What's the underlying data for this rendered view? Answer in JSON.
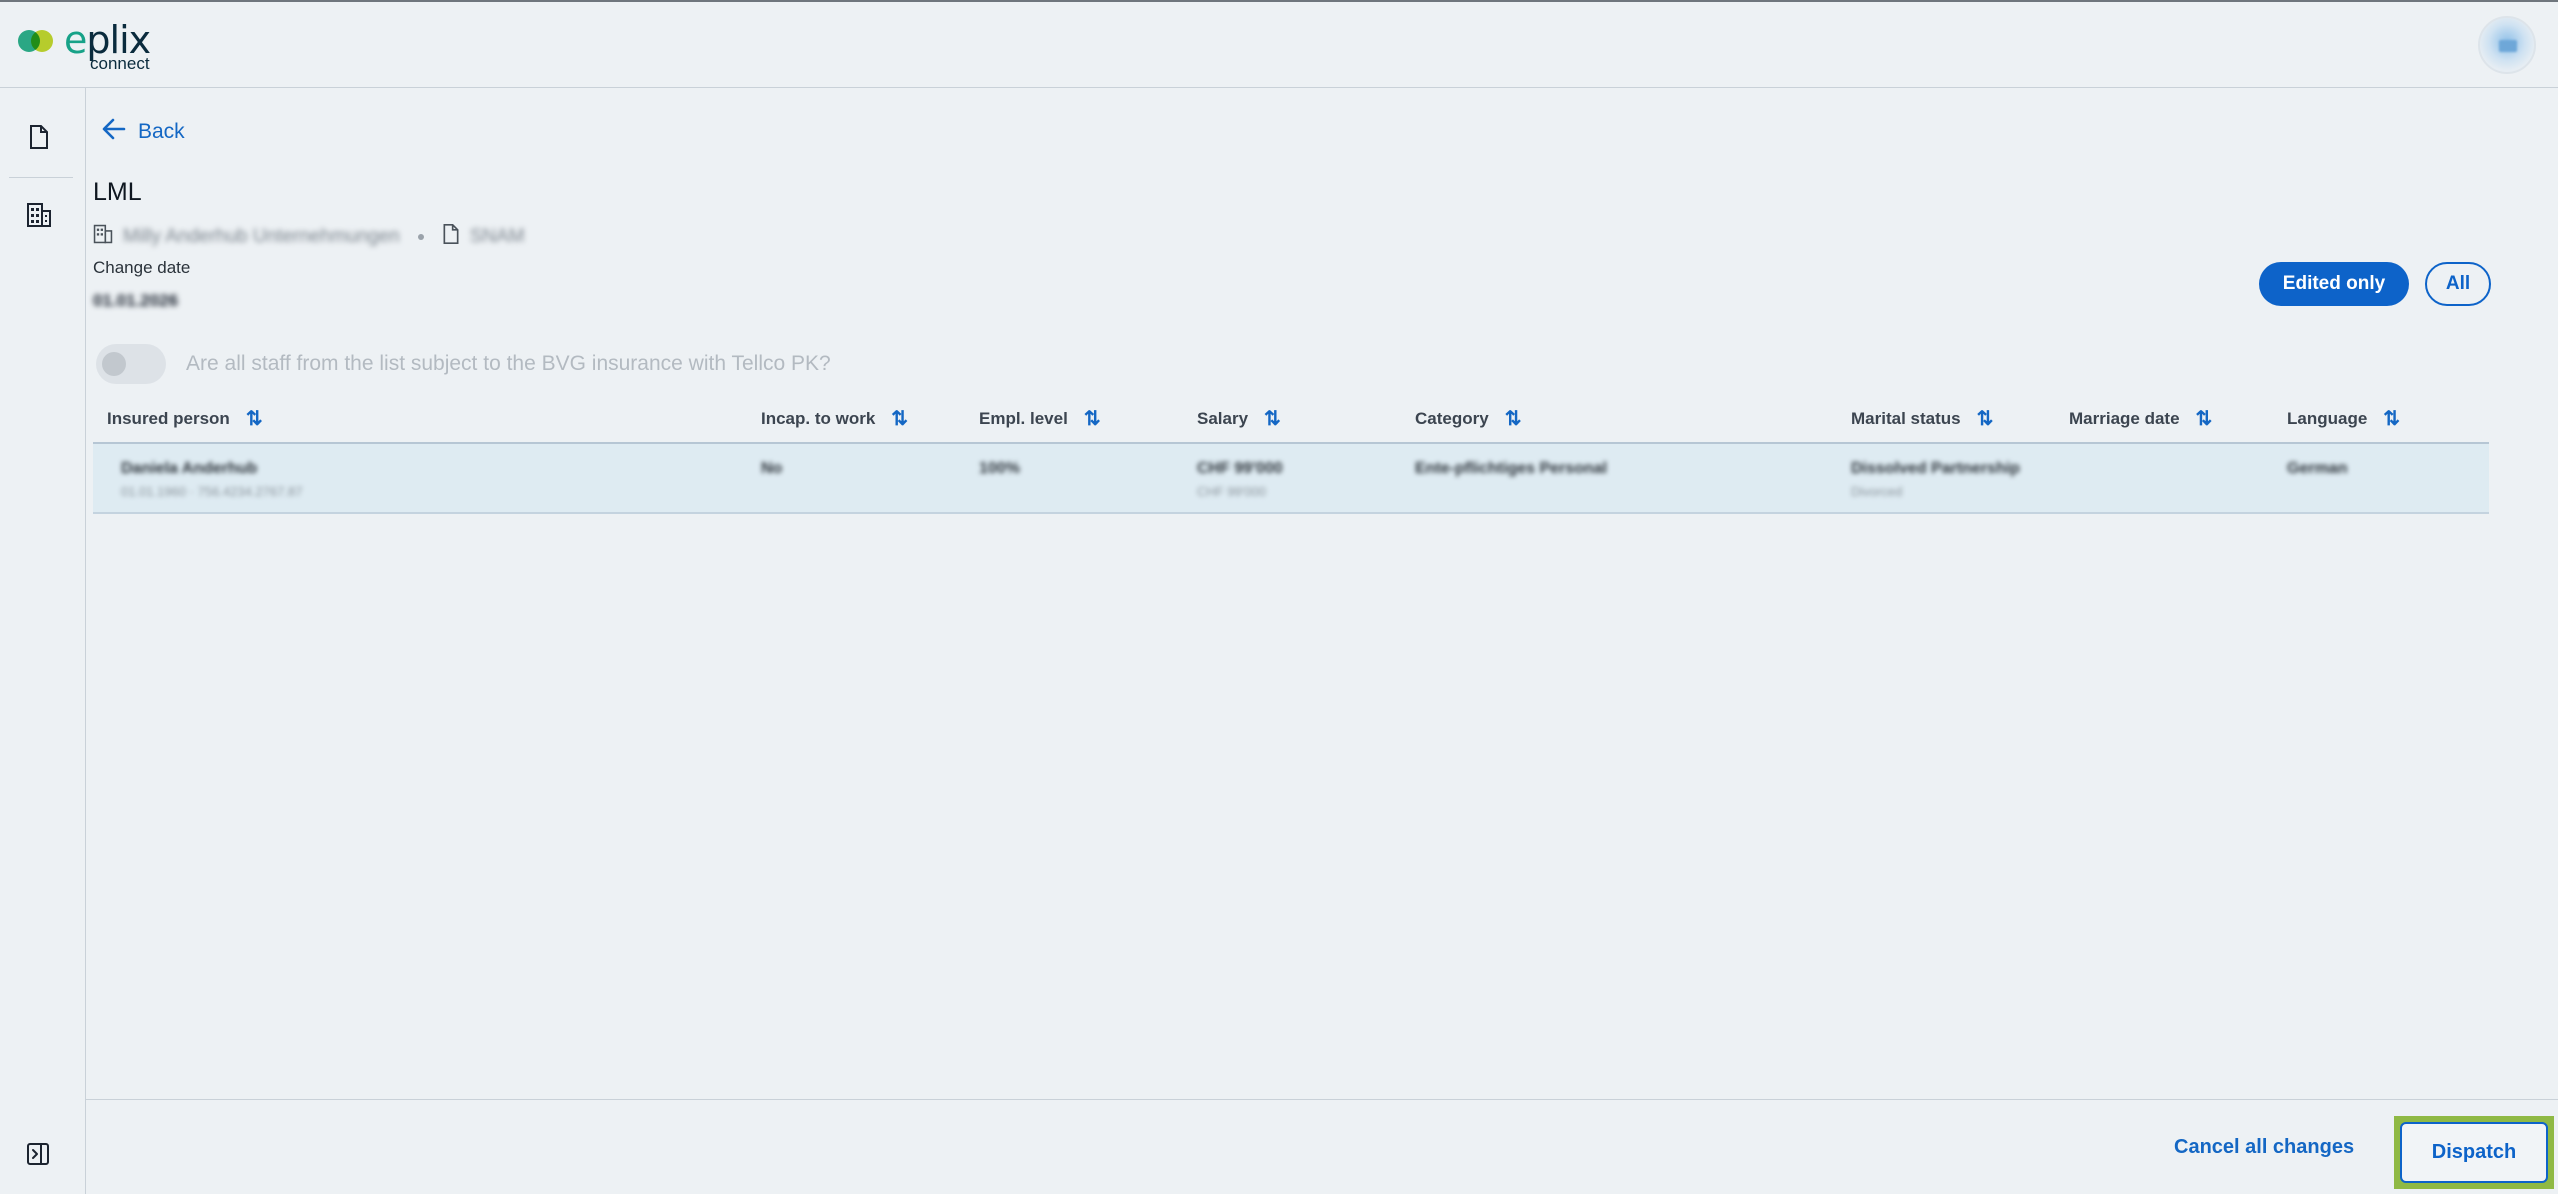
{
  "header": {
    "logo_brand_e": "e",
    "logo_brand_rest": "plix",
    "logo_sub": "connect",
    "avatar_icon": "user-avatar-icon"
  },
  "sidebar": {
    "items": [
      {
        "icon": "document-icon"
      },
      {
        "icon": "building-icon"
      }
    ],
    "collapse_icon": "sidebar-toggle-icon"
  },
  "nav": {
    "back_label": "Back"
  },
  "page": {
    "title": "LML",
    "company": "Milly Anderhub Unternehmungen",
    "doc_id": "SNAM",
    "change_date_label": "Change date",
    "change_date_value": "01.01.2026"
  },
  "filters": {
    "edited_only": "Edited only",
    "all": "All"
  },
  "toggle": {
    "label": "Are all staff from the list subject to the BVG insurance with Tellco PK?",
    "state": "off"
  },
  "table": {
    "columns": [
      "Insured person",
      "Incap. to work",
      "Empl. level",
      "Salary",
      "Category",
      "Marital status",
      "Marriage date",
      "Language"
    ],
    "rows": [
      {
        "insured_person": "Daniela Anderhub",
        "insured_person_sub": "01.01.1960 · 756.4234.2767.87",
        "incap": "No",
        "empl_level": "100%",
        "salary": "CHF 99'000",
        "salary_sub": "CHF 99'000",
        "category": "Ente-pflichtiges Personal",
        "marital_status": "Dissolved Partnership",
        "marital_status_sub": "Divorced",
        "marriage_date": "",
        "language": "German"
      }
    ]
  },
  "footer": {
    "cancel_label": "Cancel all changes",
    "dispatch_label": "Dispatch"
  },
  "colors": {
    "accent": "#0d63c9",
    "brand_green": "#17a288",
    "highlight": "#8fb944"
  }
}
